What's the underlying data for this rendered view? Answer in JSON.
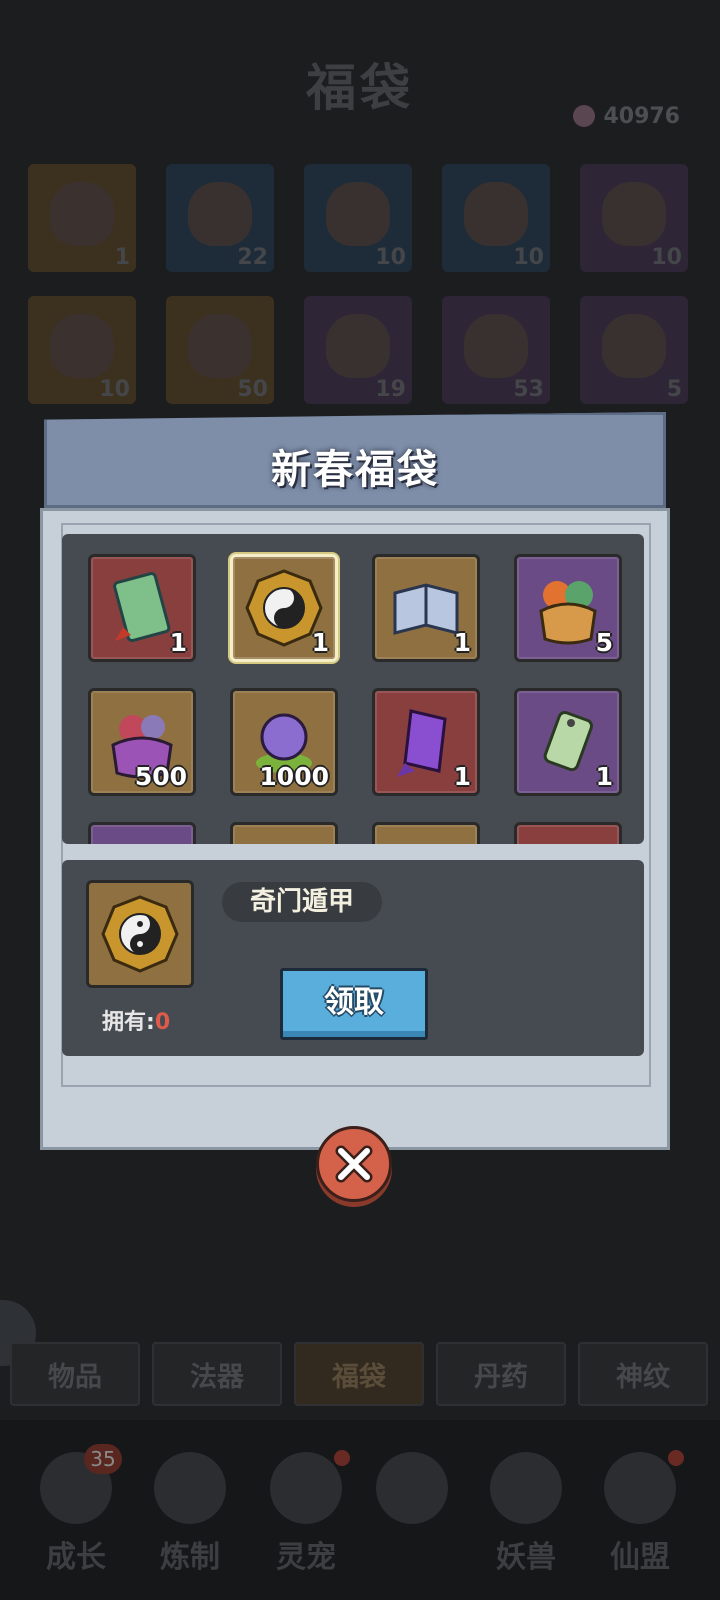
{
  "page": {
    "title": "福袋",
    "currency_amount": "40976"
  },
  "inventory": [
    {
      "count": "1",
      "tone": "gold"
    },
    {
      "count": "22",
      "tone": "blue"
    },
    {
      "count": "10",
      "tone": "blue"
    },
    {
      "count": "10",
      "tone": "blue"
    },
    {
      "count": "10",
      "tone": "purple"
    },
    {
      "count": "10",
      "tone": "gold"
    },
    {
      "count": "50",
      "tone": "gold"
    },
    {
      "count": "19",
      "tone": "purple"
    },
    {
      "count": "53",
      "tone": "purple"
    },
    {
      "count": "5",
      "tone": "purple"
    }
  ],
  "tabs": [
    "物品",
    "法器",
    "福袋",
    "丹药",
    "神纹"
  ],
  "active_tab": "福袋",
  "bottom_nav": [
    {
      "label": "成长",
      "badge": "35"
    },
    {
      "label": "炼制",
      "badge": ""
    },
    {
      "label": "灵宠",
      "badge": ""
    },
    {
      "label": "",
      "badge": ""
    },
    {
      "label": "妖兽",
      "badge": ""
    },
    {
      "label": "仙盟",
      "badge": ""
    }
  ],
  "modal": {
    "title": "新春福袋",
    "rewards": [
      {
        "icon": "scroll-icon",
        "count": "1",
        "tone": "red"
      },
      {
        "icon": "taiji-bagua-icon",
        "count": "1",
        "tone": "gold",
        "selected": true
      },
      {
        "icon": "book-icon",
        "count": "1",
        "tone": "gold"
      },
      {
        "icon": "lucky-bag-icon",
        "count": "5",
        "tone": "purple"
      },
      {
        "icon": "gem-pouch-icon",
        "count": "500",
        "tone": "gold"
      },
      {
        "icon": "spirit-orb-icon",
        "count": "1000",
        "tone": "gold"
      },
      {
        "icon": "purple-talisman-icon",
        "count": "1",
        "tone": "red"
      },
      {
        "icon": "jade-tag-icon",
        "count": "1",
        "tone": "purple"
      }
    ],
    "selected_item": {
      "name": "奇门遁甲",
      "owned_label": "拥有:",
      "owned_count": "0"
    },
    "claim_label": "领取",
    "colors": {
      "header": "#7e8ea9",
      "body": "#c7cfd8",
      "panel": "#464b52",
      "claim": "#5aaedb",
      "close": "#d4624a"
    }
  }
}
